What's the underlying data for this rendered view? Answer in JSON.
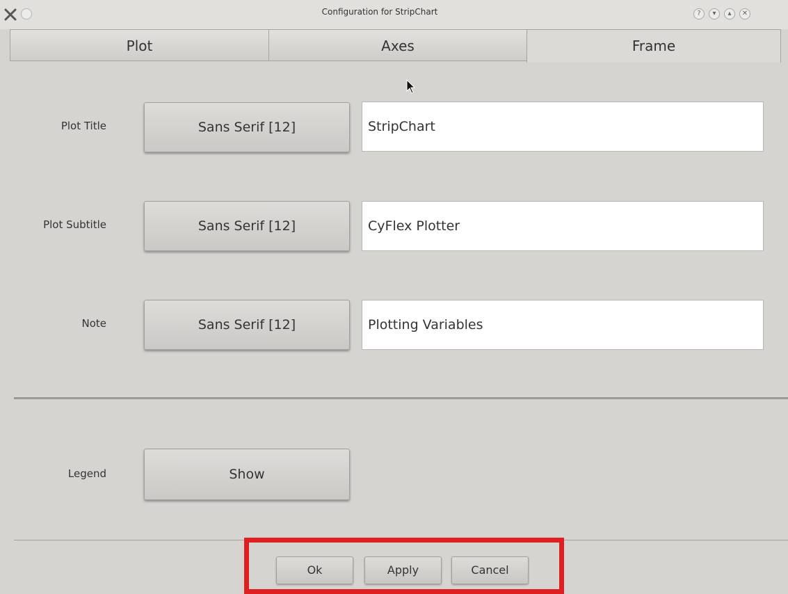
{
  "window": {
    "title": "Configuration for StripChart",
    "close_icon": "close-x-icon",
    "right_buttons": [
      "?",
      "▾",
      "▴",
      "✕"
    ]
  },
  "tabs": [
    {
      "label": "Plot",
      "active": false
    },
    {
      "label": "Axes",
      "active": false
    },
    {
      "label": "Frame",
      "active": true
    }
  ],
  "rows": [
    {
      "label": "Plot Title",
      "font_button": "Sans Serif [12]",
      "value": "StripChart"
    },
    {
      "label": "Plot Subtitle",
      "font_button": "Sans Serif [12]",
      "value": "CyFlex Plotter"
    },
    {
      "label": "Note",
      "font_button": "Sans Serif [12]",
      "value": "Plotting Variables"
    }
  ],
  "legend": {
    "label": "Legend",
    "button": "Show"
  },
  "footer": {
    "ok": "Ok",
    "apply": "Apply",
    "cancel": "Cancel"
  },
  "colors": {
    "highlight": "#e02020",
    "background": "#d6d4d1"
  }
}
